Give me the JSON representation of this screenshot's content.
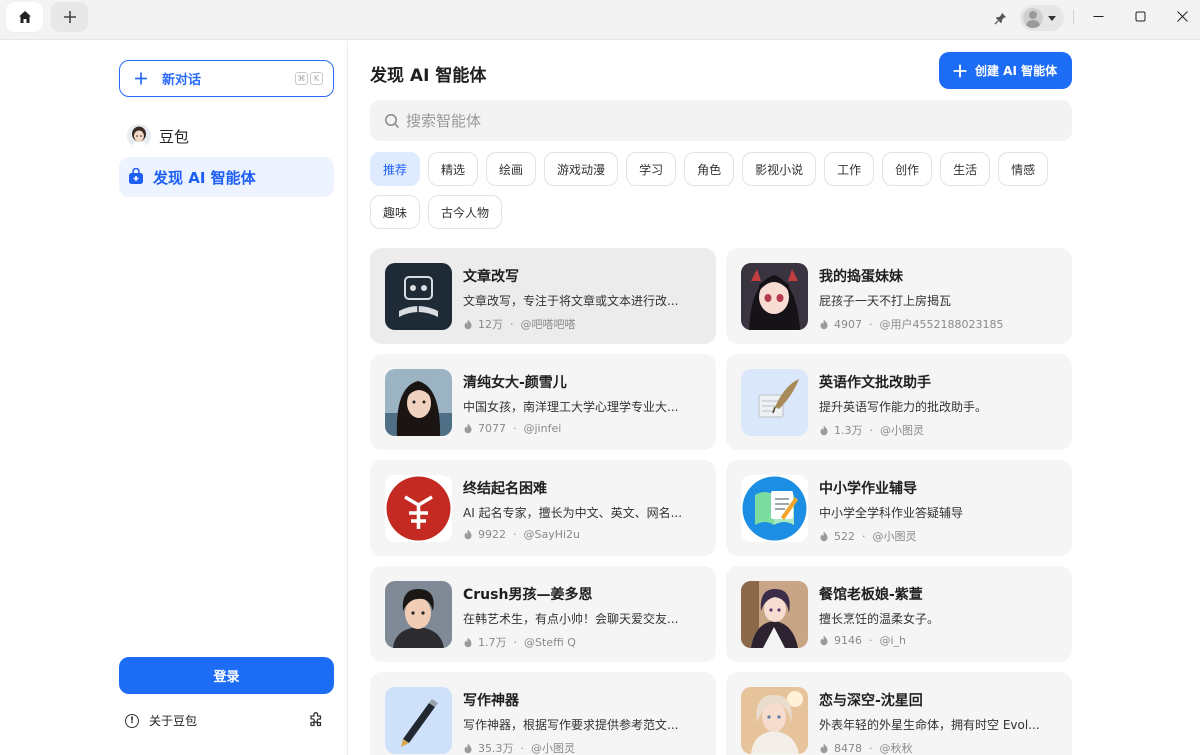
{
  "sidebar": {
    "new_chat_label": "新对话",
    "shortcut_keys": [
      "⌘",
      "K"
    ],
    "items": [
      {
        "label": "豆包"
      },
      {
        "label": "发现 AI 智能体"
      }
    ],
    "login_label": "登录",
    "about_label": "关于豆包"
  },
  "main": {
    "title": "发现 AI 智能体",
    "create_label": "创建 AI 智能体",
    "search_placeholder": "搜索智能体",
    "categories": [
      "推荐",
      "精选",
      "绘画",
      "游戏动漫",
      "学习",
      "角色",
      "影视小说",
      "工作",
      "创作",
      "生活",
      "情感",
      "趣味",
      "古今人物"
    ],
    "active_category": "推荐",
    "bots": [
      {
        "title": "文章改写",
        "desc": "文章改写，专注于将文章或文本进行改...",
        "heat": "12万",
        "author": "@吧嗒吧嗒"
      },
      {
        "title": "我的捣蛋妹妹",
        "desc": "屁孩子一天不打上房揭瓦",
        "heat": "4907",
        "author": "@用户4552188023185"
      },
      {
        "title": "清纯女大-颜雪儿",
        "desc": "中国女孩，南洋理工大学心理学专业大...",
        "heat": "7077",
        "author": "@jinfei"
      },
      {
        "title": "英语作文批改助手",
        "desc": "提升英语写作能力的批改助手。",
        "heat": "1.3万",
        "author": "@小图灵"
      },
      {
        "title": "终结起名困难",
        "desc": "AI 起名专家，擅长为中文、英文、网名...",
        "heat": "9922",
        "author": "@SayHi2u"
      },
      {
        "title": "中小学作业辅导",
        "desc": "中小学全学科作业答疑辅导",
        "heat": "522",
        "author": "@小图灵"
      },
      {
        "title": "Crush男孩—姜多恩",
        "desc": "在韩艺术生，有点小帅！会聊天爱交友...",
        "heat": "1.7万",
        "author": "@Steffi Q"
      },
      {
        "title": "餐馆老板娘-紫萱",
        "desc": "擅长烹饪的温柔女子。",
        "heat": "9146",
        "author": "@i_h"
      },
      {
        "title": "写作神器",
        "desc": "写作神器，根据写作要求提供参考范文...",
        "heat": "35.3万",
        "author": "@小图灵"
      },
      {
        "title": "恋与深空-沈星回",
        "desc": "外表年轻的外星生命体，拥有时空 Evol...",
        "heat": "8478",
        "author": "@秋秋"
      }
    ]
  },
  "colors": {
    "accent": "#1c6cf6",
    "active_chip_bg": "#deebff",
    "card_bg": "#f5f5f5"
  }
}
